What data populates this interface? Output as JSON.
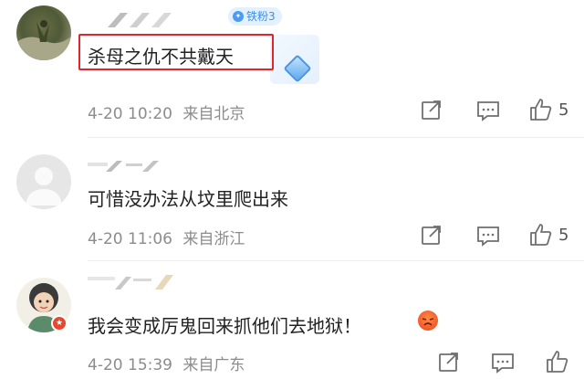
{
  "comments": [
    {
      "badge": "铁粉3",
      "text": "杀母之仇不共戴天",
      "date": "4-20",
      "time": "10:20",
      "location": "来自北京",
      "likes": "5"
    },
    {
      "text": "可惜没办法从坟里爬出来",
      "date": "4-20",
      "time": "11:06",
      "location": "来自浙江",
      "likes": "5"
    },
    {
      "text": "我会变成厉鬼回来抓他们去地狱！",
      "date": "4-20",
      "time": "15:39",
      "location": "来自广东"
    }
  ],
  "icons": {
    "share": "share-icon",
    "comment": "comment-icon",
    "like": "thumbs-up-icon",
    "emoji": "angry-face-emoji"
  },
  "colors": {
    "highlight": "#e0262a",
    "badge_text": "#3b8fe8",
    "meta_text": "#8c8c8c"
  }
}
